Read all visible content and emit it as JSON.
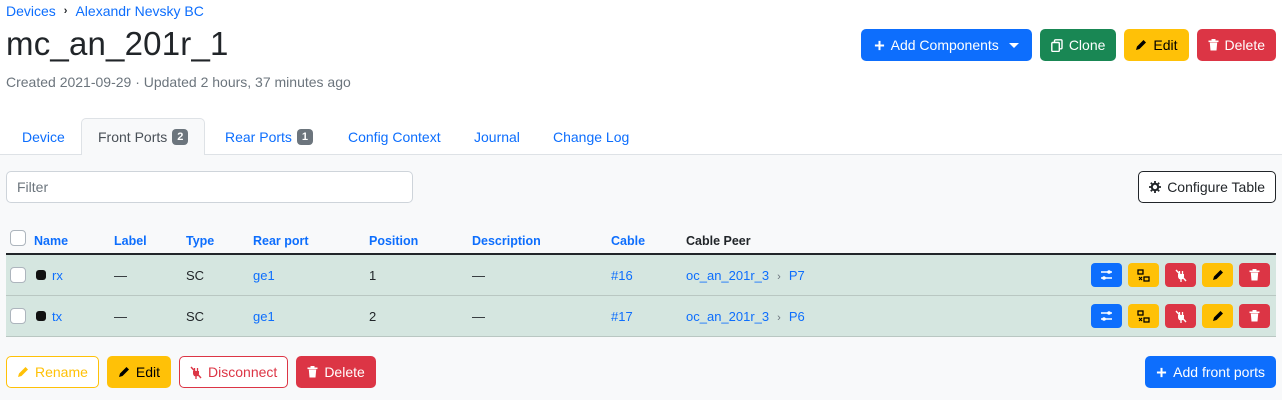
{
  "breadcrumb": {
    "items": [
      "Devices",
      "Alexandr Nevsky BC"
    ]
  },
  "page": {
    "title": "mc_an_201r_1",
    "meta": "Created 2021-09-29 · Updated 2 hours, 37 minutes ago"
  },
  "actions": {
    "add_components": "Add Components",
    "clone": "Clone",
    "edit": "Edit",
    "delete": "Delete"
  },
  "tabs": [
    {
      "label": "Device"
    },
    {
      "label": "Front Ports",
      "badge": "2",
      "active": true
    },
    {
      "label": "Rear Ports",
      "badge": "1"
    },
    {
      "label": "Config Context"
    },
    {
      "label": "Journal"
    },
    {
      "label": "Change Log"
    }
  ],
  "filter": {
    "placeholder": "Filter"
  },
  "configure_table": "Configure Table",
  "table": {
    "columns": [
      "Name",
      "Label",
      "Type",
      "Rear port",
      "Position",
      "Description",
      "Cable",
      "Cable Peer"
    ],
    "rows": [
      {
        "name": "rx",
        "label": "—",
        "type": "SC",
        "rear_port": "ge1",
        "position": "1",
        "description": "—",
        "cable": "#16",
        "peer_device": "oc_an_201r_3",
        "peer_port": "P7"
      },
      {
        "name": "tx",
        "label": "—",
        "type": "SC",
        "rear_port": "ge1",
        "position": "2",
        "description": "—",
        "cable": "#17",
        "peer_device": "oc_an_201r_3",
        "peer_port": "P6"
      }
    ]
  },
  "bulk": {
    "rename": "Rename",
    "edit": "Edit",
    "disconnect": "Disconnect",
    "delete": "Delete",
    "add_front_ports": "Add front ports"
  },
  "colors": {
    "primary": "#0d6efd",
    "success": "#198754",
    "warning": "#ffc107",
    "danger": "#dc3545",
    "row_connected": "#d5e6e0"
  }
}
